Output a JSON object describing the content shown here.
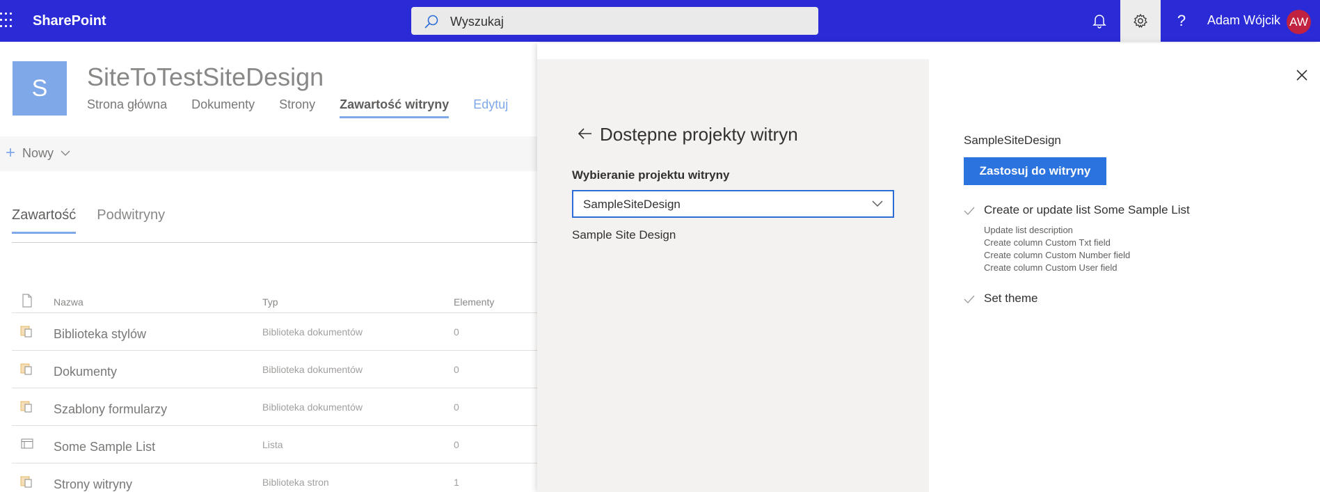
{
  "suitebar": {
    "brand": "SharePoint",
    "search_placeholder": "Wyszukaj",
    "user_name": "Adam Wójcik",
    "user_initials": "AW"
  },
  "site": {
    "logo_letter": "S",
    "title": "SiteToTestSiteDesign",
    "nav": [
      "Strona główna",
      "Dokumenty",
      "Strony",
      "Zawartość witryny",
      "Edytuj"
    ]
  },
  "commandbar": {
    "new_label": "Nowy"
  },
  "content_tabs": [
    "Zawartość",
    "Podwitryny"
  ],
  "list": {
    "headers": {
      "name": "Nazwa",
      "type": "Typ",
      "items": "Elementy"
    },
    "rows": [
      {
        "icon": "document-library-icon",
        "name": "Biblioteka stylów",
        "type": "Biblioteka dokumentów",
        "items": "0"
      },
      {
        "icon": "document-library-icon",
        "name": "Dokumenty",
        "type": "Biblioteka dokumentów",
        "items": "0"
      },
      {
        "icon": "document-library-icon",
        "name": "Szablony formularzy",
        "type": "Biblioteka dokumentów",
        "items": "0"
      },
      {
        "icon": "list-icon",
        "name": "Some Sample List",
        "type": "Lista",
        "items": "0"
      },
      {
        "icon": "document-library-icon",
        "name": "Strony witryny",
        "type": "Biblioteka stron",
        "items": "1"
      }
    ]
  },
  "panel": {
    "heading": "Dostępne projekty witryn",
    "select_label": "Wybieranie projektu witryny",
    "selected_value": "SampleSiteDesign",
    "design_description": "Sample Site Design",
    "right_title": "SampleSiteDesign",
    "apply_label": "Zastosuj do witryny",
    "actions": [
      {
        "title": "Create or update list Some Sample List",
        "subactions": [
          "Update list description",
          "Create column Custom Txt field",
          "Create column Custom Number field",
          "Create column Custom User field"
        ]
      },
      {
        "title": "Set theme",
        "subactions": []
      }
    ]
  },
  "colors": {
    "suitebar": "#2a2ad6",
    "accent": "#2b74e0",
    "avatar": "#c0223f",
    "site_logo": "#7fa8e8"
  }
}
